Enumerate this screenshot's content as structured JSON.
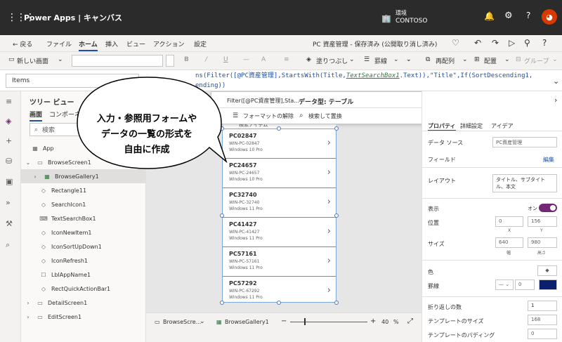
{
  "titlebar": {
    "brand": "Power Apps | キャンバス",
    "env_label": "環境",
    "env_name": "CONTOSO",
    "avatar": "◕"
  },
  "menubar": {
    "back": "← 戻る",
    "items": [
      "ファイル",
      "ホーム",
      "挿入",
      "ビュー",
      "アクション",
      "設定"
    ],
    "app_title": "PC 資産管理 - 保存済み (公開取り消し済み)"
  },
  "toolbar": {
    "new_screen": "新しい画面",
    "fill": "塗りつぶし",
    "border": "罫線",
    "reorder": "再配列",
    "align": "配置",
    "group": "グループ"
  },
  "formula": {
    "property": "Items",
    "line1_pre": "ns(Filter([@PC資産管理],StartsWith(Title,",
    "line1_ctl": "TextSearchBox1",
    "line1_post": ".Text)),\"Title\",If(SortDescending1,",
    "line2": "ending))"
  },
  "popup": {
    "left_text": "Filter([@PC資産管理],Sta...",
    "data_type": "データ型: テーブル",
    "remove_format": "フォーマットの解除",
    "find_replace": "検索して置換"
  },
  "tree": {
    "title": "ツリー ビュー",
    "tab_screens": "画面",
    "tab_components": "コンポーネ",
    "search_placeholder": "検索",
    "items": [
      "App",
      "BrowseScreen1",
      "BrowseGallery1",
      "Rectangle11",
      "SearchIcon1",
      "TextSearchBox1",
      "IconNewItem1",
      "IconSortUpDown1",
      "IconRefresh1",
      "LblAppName1",
      "RectQuickActionBar1",
      "DetailScreen1",
      "EditScreen1"
    ]
  },
  "canvas": {
    "search_text": "検索アイテム",
    "gallery": [
      {
        "title": "PC02847",
        "sub": "WIN-PC-02847",
        "os": "Windows 10 Pro"
      },
      {
        "title": "PC24657",
        "sub": "WIN-PC-24657",
        "os": "Windows 10 Pro"
      },
      {
        "title": "PC32740",
        "sub": "WIN-PC-32740",
        "os": "Windows 11 Pro"
      },
      {
        "title": "PC41427",
        "sub": "WIN-PC-41427",
        "os": "Windows 11 Pro"
      },
      {
        "title": "PC57161",
        "sub": "WIN-PC-57161",
        "os": "Windows 11 Pro"
      },
      {
        "title": "PC57292",
        "sub": "WIN-PC-67292",
        "os": "Windows 11 Pro"
      }
    ]
  },
  "status": {
    "screen": "BrowseScre...",
    "gallery": "BrowseGallery1",
    "zoom": "40",
    "zoom_unit": "%"
  },
  "rpanel": {
    "tab1": "プロパティ",
    "tab2": "詳細設定",
    "tab3": "アイデア",
    "datasource_label": "データ ソース",
    "datasource_value": "PC資産管理",
    "fields_label": "フィールド",
    "fields_link": "編集",
    "layout_label": "レイアウト",
    "layout_value": "タイトル、サブタイトル、本文",
    "visible_label": "表示",
    "visible_value": "オン",
    "position_label": "位置",
    "pos_x": "0",
    "pos_y": "156",
    "x_label": "X",
    "y_label": "Y",
    "size_label": "サイズ",
    "width": "640",
    "height": "980",
    "w_label": "幅",
    "h_label": "高さ",
    "color_label": "色",
    "border_label": "罫線",
    "border_width": "0",
    "border_color": "#0b1f6e",
    "wrap_label": "折り返しの数",
    "wrap_value": "1",
    "template_label": "テンプレートのサイズ",
    "template_value": "168",
    "padding_label": "テンプレートのパディング",
    "padding_value": "0"
  },
  "callout": {
    "line1": "入力・参照用フォームや",
    "line2": "データの一覧の形式を",
    "line3": "自由に作成"
  },
  "colors": {
    "titlebar": "#2b2b2b",
    "accent": "#1e4fa3",
    "toggle": "#742774"
  }
}
